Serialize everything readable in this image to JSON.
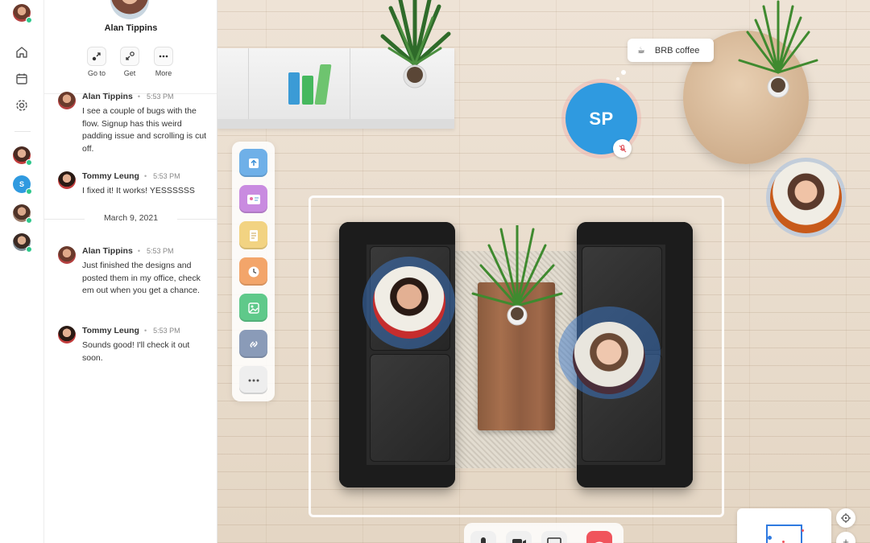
{
  "sidebar": {
    "items": [
      {
        "name": "home-icon"
      },
      {
        "name": "calendar-icon"
      },
      {
        "name": "gear-icon"
      }
    ],
    "presence_dot_color": "#2fc78c",
    "people_initial": "S"
  },
  "profile": {
    "name": "Alan Tippins",
    "actions": [
      {
        "label": "Go to",
        "icon": "go-to-icon"
      },
      {
        "label": "Get",
        "icon": "get-icon"
      },
      {
        "label": "More",
        "icon": "more-icon"
      }
    ]
  },
  "chat": {
    "messages": [
      {
        "author": "Alan Tippins",
        "time": "5:53 PM",
        "text": "I see a couple of bugs with the flow. Signup has this weird padding issue and scrolling is cut off."
      },
      {
        "author": "Tommy Leung",
        "time": "5:53 PM",
        "text": "I fixed it! It works! YESSSSSS"
      },
      {
        "author": "Alan Tippins",
        "time": "5:53 PM",
        "text": "Just finished the designs and posted them in my office, check em out when you get a chance."
      },
      {
        "author": "Tommy Leung",
        "time": "5:53 PM",
        "text": "Sounds good! I'll check it out soon."
      }
    ],
    "date_separator": "March 9, 2021",
    "bullet": "•"
  },
  "room": {
    "status": {
      "text": "BRB coffee",
      "icon": "coffee-cup-icon"
    },
    "sp_avatar": {
      "initials": "SP",
      "color": "#2f9ae0",
      "muted": true
    },
    "accent": "#2f7ae0",
    "hangup_color": "#f0545c"
  },
  "tools": [
    {
      "name": "upload-icon",
      "color": "#6fb0e8"
    },
    {
      "name": "whiteboard-icon",
      "color": "#c98be0"
    },
    {
      "name": "note-icon",
      "color": "#f2d382"
    },
    {
      "name": "timer-icon",
      "color": "#f3a56a"
    },
    {
      "name": "image-icon",
      "color": "#5fc98a"
    },
    {
      "name": "link-icon",
      "color": "#8a9bb8"
    },
    {
      "name": "more-tools-icon",
      "color": "#eeeeee"
    }
  ],
  "zoom": {
    "plus": "+"
  }
}
